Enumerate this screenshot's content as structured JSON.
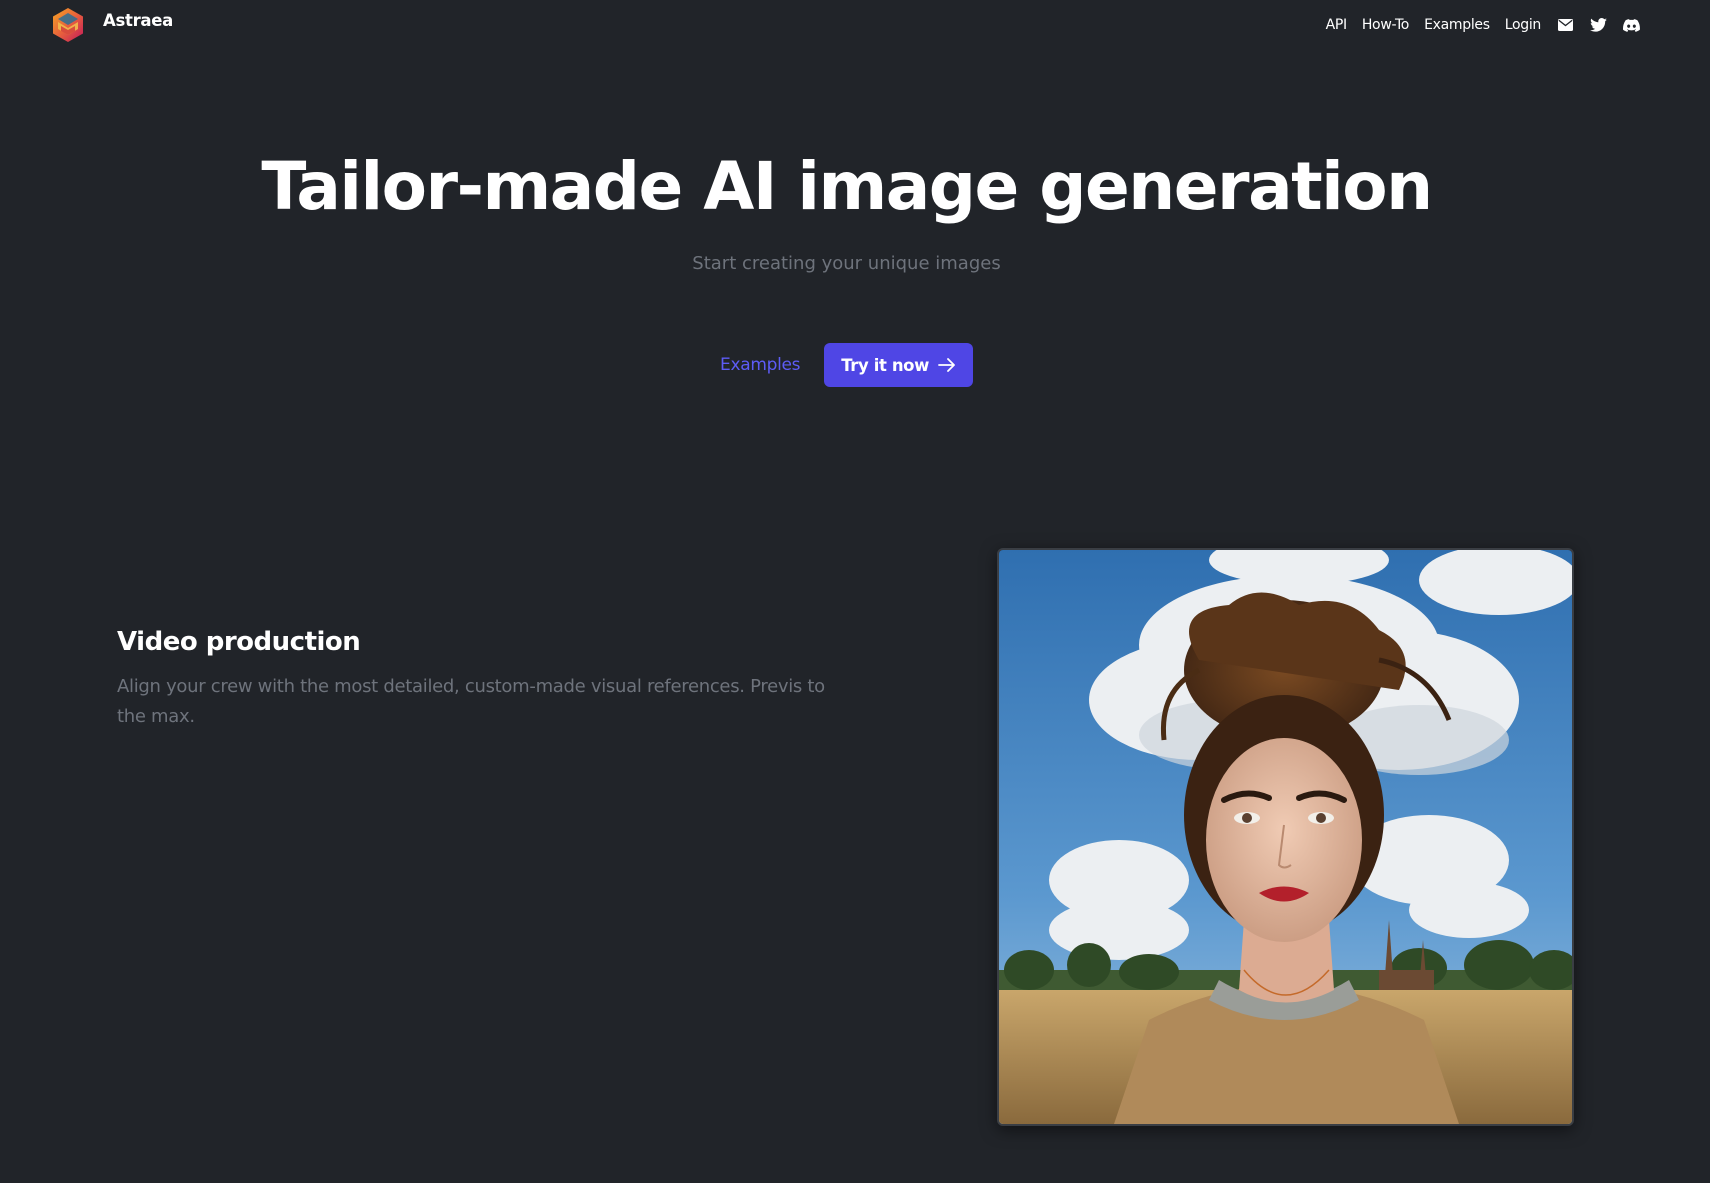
{
  "header": {
    "brand": "Astraea",
    "logo_icon": "astraea-hexagon-logo",
    "nav": [
      "API",
      "How-To",
      "Examples",
      "Login"
    ],
    "icons": [
      "mail-icon",
      "twitter-icon",
      "discord-icon"
    ]
  },
  "hero": {
    "title": "Tailor-made AI image generation",
    "subtitle": "Start creating your unique images",
    "secondary_cta": "Examples",
    "primary_cta": "Try it now",
    "primary_cta_icon": "arrow-right-icon"
  },
  "feature": {
    "title": "Video production",
    "description": "Align your crew with the most detailed, custom-made visual references. Previs to the max.",
    "image": "ai-portrait-woman-clouds-field"
  },
  "colors": {
    "background": "#212429",
    "accent": "#4f46e5",
    "link": "#5d5cf6",
    "muted_text": "#6e737c"
  }
}
